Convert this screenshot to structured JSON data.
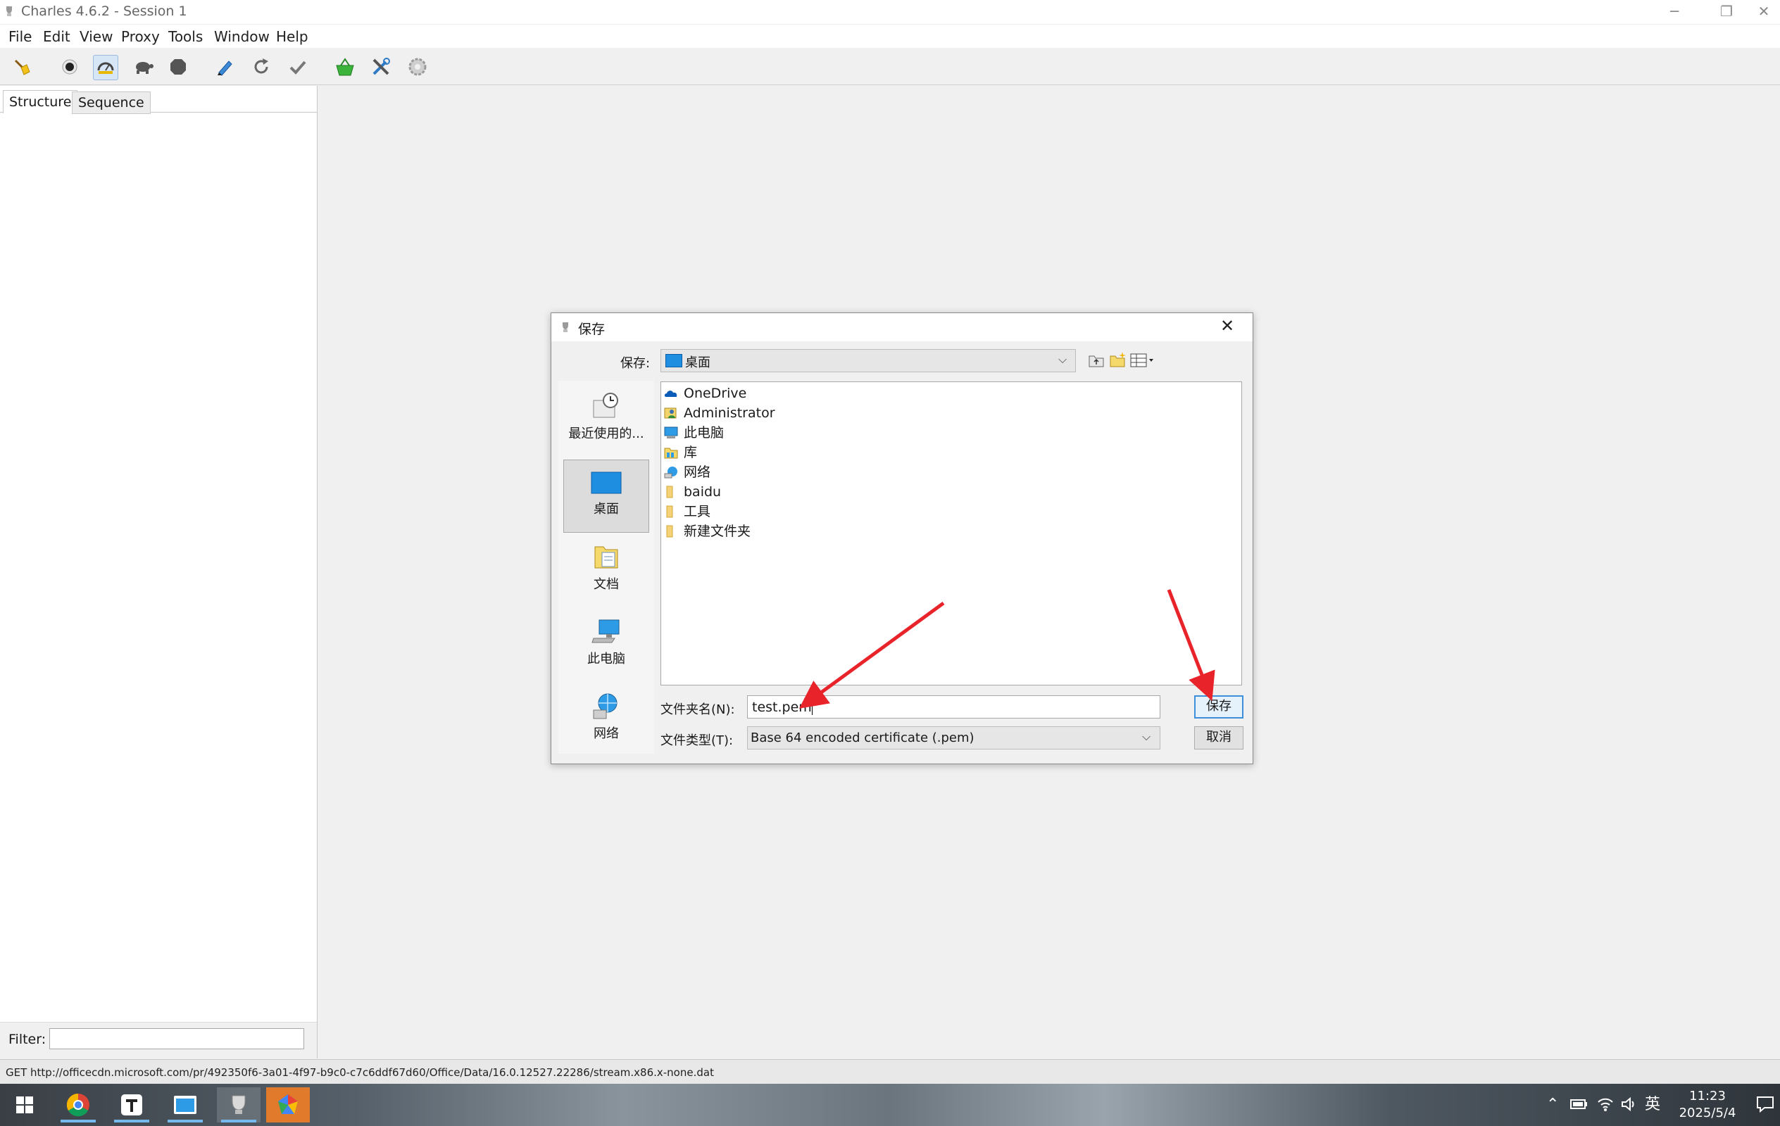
{
  "window": {
    "title": "Charles 4.6.2 - Session 1",
    "minimize_glyph": "─",
    "restore_glyph": "❐",
    "close_glyph": "✕"
  },
  "menubar": {
    "items": [
      "File",
      "Edit",
      "View",
      "Proxy",
      "Tools",
      "Window",
      "Help"
    ]
  },
  "toolbar": {
    "buttons": [
      "broom-icon",
      "record-icon",
      "throttle-icon",
      "turtle-icon",
      "stop-icon",
      "pen-icon",
      "refresh-icon",
      "check-icon",
      "basket-icon",
      "tools-icon",
      "settings-icon"
    ]
  },
  "left_panel": {
    "tabs": [
      "Structure",
      "Sequence"
    ],
    "filter_label": "Filter:",
    "filter_value": ""
  },
  "status": {
    "text": "GET http://officecdn.microsoft.com/pr/492350f6-3a01-4f97-b9c0-c7c6ddf67d60/Office/Data/16.0.12527.22286/stream.x86.x-none.dat"
  },
  "dialog": {
    "title": "保存",
    "save_in_label": "保存:",
    "save_in_value": "桌面",
    "places": [
      {
        "label": "最近使用的...",
        "icon": "recent-icon",
        "selected": false
      },
      {
        "label": "桌面",
        "icon": "desktop-icon",
        "selected": true
      },
      {
        "label": "文档",
        "icon": "documents-icon",
        "selected": false
      },
      {
        "label": "此电脑",
        "icon": "computer-icon",
        "selected": false
      },
      {
        "label": "网络",
        "icon": "network-icon",
        "selected": false
      }
    ],
    "files": [
      {
        "name": "OneDrive",
        "icon": "onedrive-icon"
      },
      {
        "name": "Administrator",
        "icon": "user-icon"
      },
      {
        "name": "此电脑",
        "icon": "computer-icon"
      },
      {
        "name": "库",
        "icon": "library-icon"
      },
      {
        "name": "网络",
        "icon": "network-icon"
      },
      {
        "name": "baidu",
        "icon": "folder-icon"
      },
      {
        "name": "工具",
        "icon": "folder-icon"
      },
      {
        "name": "新建文件夹",
        "icon": "folder-icon"
      }
    ],
    "filename_label": "文件夹名(N):",
    "filename_value": "test.pem",
    "filetype_label": "文件类型(T):",
    "filetype_value": "Base 64 encoded certificate (.pem)",
    "save_button": "保存",
    "cancel_button": "取消",
    "close_glyph": "✕"
  },
  "taskbar": {
    "apps": [
      "windows-start-icon",
      "chrome-icon",
      "typora-icon",
      "file-explorer-icon",
      "charles-icon",
      "colorful-app-icon"
    ],
    "ime": "英",
    "time": "11:23",
    "date": "2025/5/4"
  },
  "colors": {
    "annotation_arrow": "#e8232a",
    "accent": "#3c8fd8"
  }
}
